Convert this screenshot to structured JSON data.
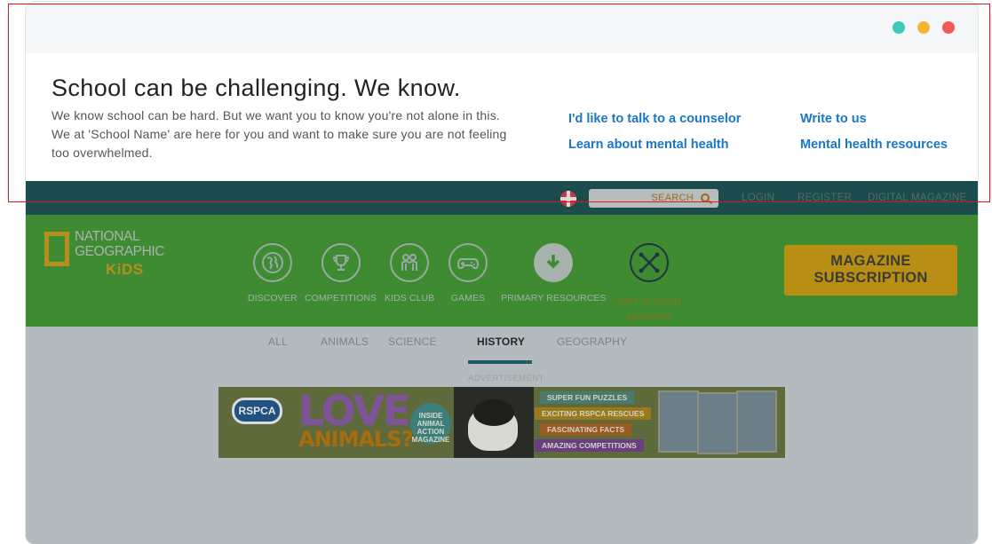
{
  "banner": {
    "title": "School can be challenging. We know.",
    "text": "We know school can be hard. But we want you to know you're not alone in this. We at 'School Name' are here for you and want to make sure you are not feeling too overwhelmed.",
    "links": [
      "I'd like to talk to a counselor",
      "Write to us",
      "Learn about mental health",
      "Mental health resources"
    ]
  },
  "window_dots": {
    "colors": [
      "#3ec9b8",
      "#f2b632",
      "#f25a5a"
    ]
  },
  "topnav": {
    "search_label": "SEARCH",
    "login": "LOGIN",
    "register": "REGISTER",
    "digital_magazine": "DIGITAL MAGAZINE"
  },
  "logo": {
    "line1": "NATIONAL",
    "line2": "GEOGRAPHIC",
    "line3": "KiDS"
  },
  "mainnav": {
    "items": [
      {
        "label": "DISCOVER",
        "icon": "globe-icon"
      },
      {
        "label": "COMPETITIONS",
        "icon": "trophy-icon"
      },
      {
        "label": "KIDS CLUB",
        "icon": "kids-icon"
      },
      {
        "label": "GAMES",
        "icon": "gamepad-icon"
      },
      {
        "label": "PRIMARY RESOURCES",
        "icon": "download-icon"
      }
    ],
    "dirt_label_1": "DIRT IS GOOD",
    "dirt_label_2": "ACADEMY",
    "magazine_line1": "MAGAZINE",
    "magazine_line2": "SUBSCRIPTION"
  },
  "categories": {
    "tabs": [
      "ALL",
      "ANIMALS",
      "SCIENCE",
      "HISTORY",
      "GEOGRAPHY"
    ],
    "active": "HISTORY"
  },
  "ad": {
    "label": "ADVERTISEMENT",
    "rspca": "RSPCA",
    "love": "LOVE",
    "animals": "ANIMALS?",
    "badge": "INSIDE ANIMAL ACTION MAGAZINE",
    "pills": [
      "SUPER FUN PUZZLES",
      "EXCITING RSPCA RESCUES",
      "FASCINATING FACTS",
      "AMAZING COMPETITIONS"
    ]
  },
  "colors": {
    "link": "#1976c9",
    "topnav": "#1d4c4e",
    "mainnav": "#3f8b32",
    "highlight": "#e0161b"
  }
}
